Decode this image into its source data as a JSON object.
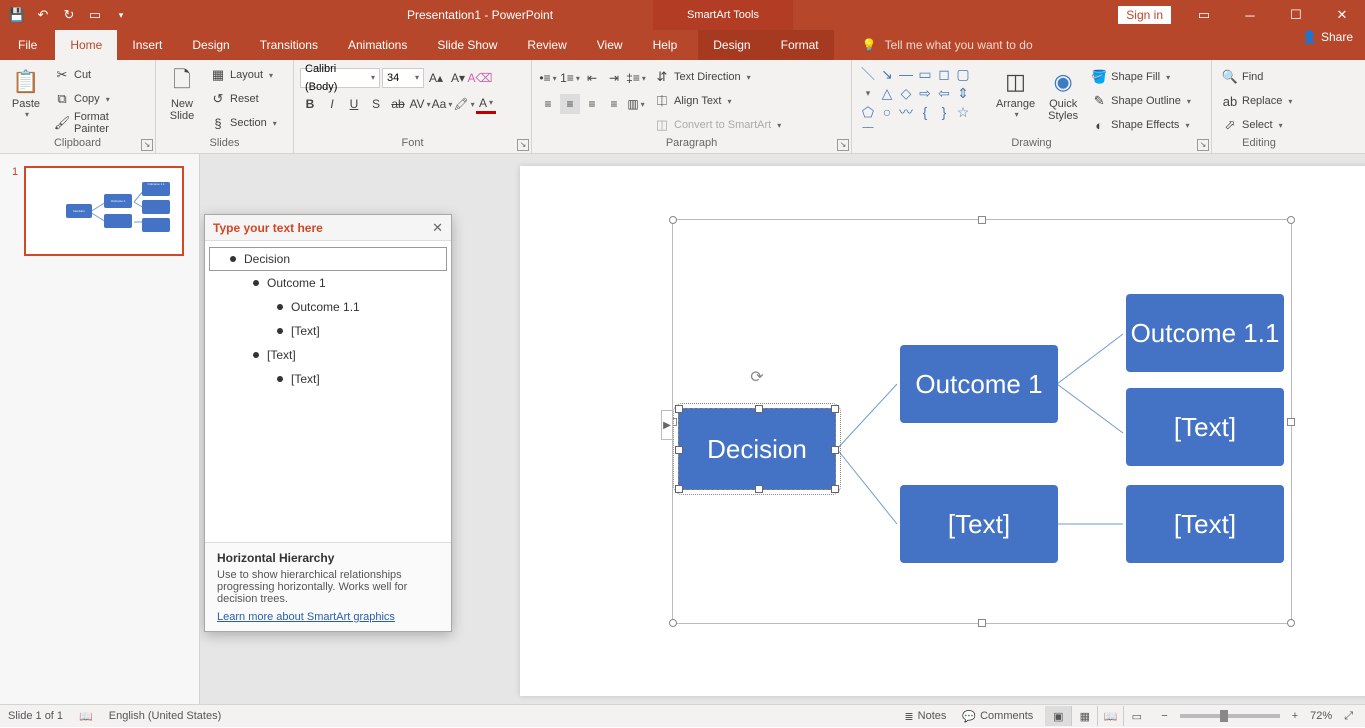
{
  "title": {
    "doc": "Presentation1",
    "app": " - PowerPoint",
    "contextual": "SmartArt Tools"
  },
  "signin": "Sign in",
  "tabs": {
    "file": "File",
    "home": "Home",
    "insert": "Insert",
    "design": "Design",
    "transitions": "Transitions",
    "animations": "Animations",
    "slideshow": "Slide Show",
    "review": "Review",
    "view": "View",
    "help": "Help",
    "sa_design": "Design",
    "sa_format": "Format",
    "tellme": "Tell me what you want to do",
    "share": "Share"
  },
  "ribbon": {
    "clipboard": {
      "label": "Clipboard",
      "paste": "Paste",
      "cut": "Cut",
      "copy": "Copy",
      "format_painter": "Format Painter"
    },
    "slides": {
      "label": "Slides",
      "new_slide": "New\nSlide",
      "layout": "Layout",
      "reset": "Reset",
      "section": "Section"
    },
    "font": {
      "label": "Font",
      "name": "Calibri (Body)",
      "size": "34"
    },
    "paragraph": {
      "label": "Paragraph",
      "text_direction": "Text Direction",
      "align_text": "Align Text",
      "convert": "Convert to SmartArt"
    },
    "drawing": {
      "label": "Drawing",
      "arrange": "Arrange",
      "quick_styles": "Quick\nStyles",
      "fill": "Shape Fill",
      "outline": "Shape Outline",
      "effects": "Shape Effects"
    },
    "editing": {
      "label": "Editing",
      "find": "Find",
      "replace": "Replace",
      "select": "Select"
    }
  },
  "thumb_num": "1",
  "smartart": {
    "node_root": "Decision",
    "node_a": "Outcome 1",
    "node_a1": "Outcome 1.1",
    "node_a2": "[Text]",
    "node_b": "[Text]",
    "node_b1": "[Text]"
  },
  "text_pane": {
    "header": "Type your text here",
    "items": [
      {
        "indent": 0,
        "text": "Decision",
        "sel": true
      },
      {
        "indent": 1,
        "text": "Outcome 1"
      },
      {
        "indent": 2,
        "text": "Outcome 1.1"
      },
      {
        "indent": 2,
        "text": "[Text]"
      },
      {
        "indent": 1,
        "text": "[Text]"
      },
      {
        "indent": 2,
        "text": "[Text]"
      }
    ],
    "footer_title": "Horizontal Hierarchy",
    "footer_body": "Use to show hierarchical relationships progressing horizontally. Works well for decision trees.",
    "footer_link": "Learn more about SmartArt graphics"
  },
  "status": {
    "slide": "Slide 1 of 1",
    "lang": "English (United States)",
    "notes": "Notes",
    "comments": "Comments",
    "zoom": "72%"
  }
}
